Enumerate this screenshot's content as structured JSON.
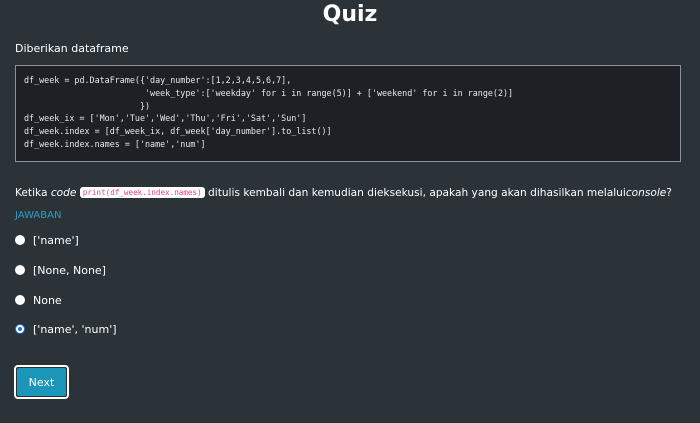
{
  "header": {
    "title": "Quiz"
  },
  "prompt": {
    "intro": "Diberikan dataframe",
    "code_lines": [
      "df_week = pd.DataFrame({'day_number':[1,2,3,4,5,6,7],",
      "                        'week_type':['weekday' for i in range(5)] + ['weekend' for i in range(2)]",
      "                       })",
      "df_week_ix = ['Mon','Tue','Wed','Thu','Fri','Sat','Sun']",
      "df_week.index = [df_week_ix, df_week['day_number'].to_list()]",
      "df_week.index.names = ['name','num']"
    ]
  },
  "question": {
    "prefix": "Ketika ",
    "code_word": "code",
    "inline_code": "print(df_week.index.names)",
    "middle": " ditulis kembali dan kemudian dieksekusi, apakah yang akan dihasilkan melalui",
    "console_word": "console",
    "suffix": "?"
  },
  "answer": {
    "label": "JAWABAN",
    "options": [
      {
        "label": "['name']",
        "selected": false
      },
      {
        "label": "[None, None]",
        "selected": false
      },
      {
        "label": "None",
        "selected": false
      },
      {
        "label": "['name', 'num']",
        "selected": true
      }
    ]
  },
  "actions": {
    "next_label": "Next"
  },
  "colors": {
    "background": "#2b3238",
    "code_background": "#1d2125",
    "accent": "#1b95b8",
    "answer_label": "#2c9ec4",
    "inline_code_text": "#e83e8c",
    "radio_checked": "#1e73d8"
  }
}
